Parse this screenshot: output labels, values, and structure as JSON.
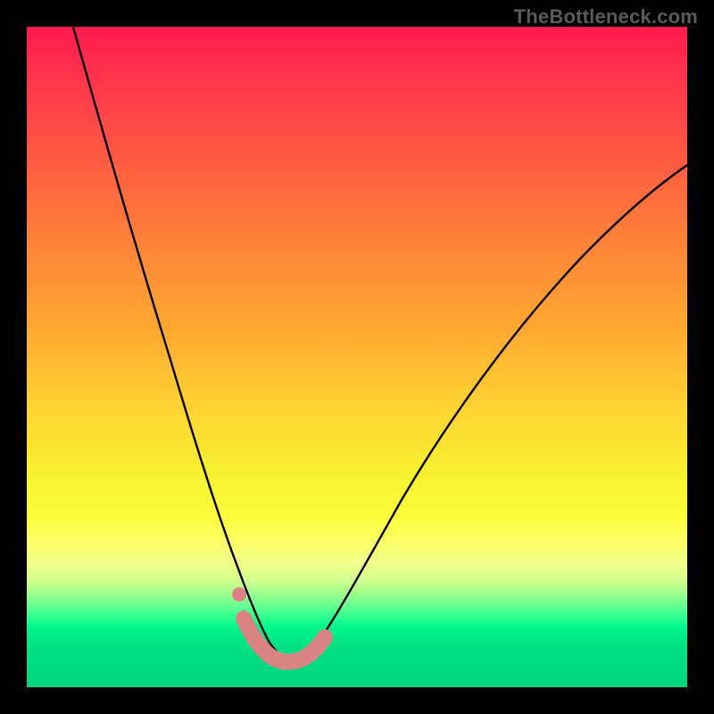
{
  "attribution": "TheBottleneck.com",
  "chart_data": {
    "type": "line",
    "title": "",
    "xlabel": "",
    "ylabel": "",
    "xlim": [
      0,
      100
    ],
    "ylim": [
      0,
      100
    ],
    "series": [
      {
        "name": "bottleneck-curve",
        "x": [
          7,
          10,
          14,
          18,
          22,
          26,
          29,
          31,
          33,
          35,
          37,
          39,
          41,
          43,
          46,
          50,
          55,
          62,
          70,
          80,
          92,
          100
        ],
        "y": [
          100,
          84,
          67,
          53,
          40,
          29,
          21,
          15,
          11,
          8,
          6,
          5,
          4.5,
          5,
          6,
          9,
          14,
          22,
          32,
          44,
          57,
          65
        ]
      }
    ],
    "highlight": {
      "name": "optimal-zone",
      "x": [
        32.5,
        34,
        35.5,
        37,
        38.5,
        40,
        41.5,
        43,
        44.5
      ],
      "y": [
        10.5,
        8,
        6.2,
        5.2,
        4.7,
        4.7,
        4.9,
        5.8,
        7.5
      ],
      "note": "isolated-dot at approx (32.2, 14.5)"
    },
    "gradient_stops": [
      {
        "pos": 0,
        "color": "#ff1a4f"
      },
      {
        "pos": 46,
        "color": "#ffa931"
      },
      {
        "pos": 74,
        "color": "#fdfd3a"
      },
      {
        "pos": 89,
        "color": "#28ff8f"
      },
      {
        "pos": 100,
        "color": "#00d57e"
      }
    ]
  }
}
